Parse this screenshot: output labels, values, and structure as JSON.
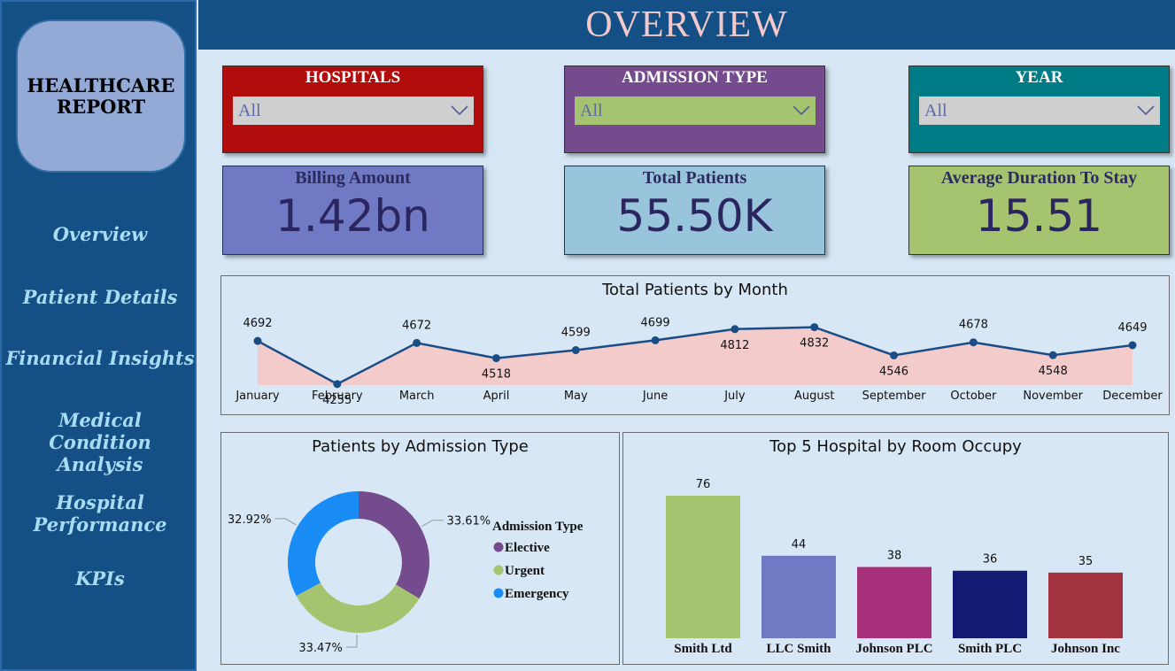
{
  "sidebar": {
    "report_title": "HEALTHCARE REPORT",
    "nav": [
      {
        "label": "Overview"
      },
      {
        "label": "Patient Details"
      },
      {
        "label": "Financial Insights"
      },
      {
        "label": "Medical Condition Analysis"
      },
      {
        "label": "Hospital Performance"
      },
      {
        "label": "KPIs"
      }
    ]
  },
  "header": {
    "title": "OVERVIEW"
  },
  "filters": {
    "hospitals": {
      "label": "HOSPITALS",
      "value": "All",
      "color": "#b20d0d"
    },
    "admission_type": {
      "label": "ADMISSION TYPE",
      "value": "All",
      "color": "#744b8c"
    },
    "year": {
      "label": "YEAR",
      "value": "All",
      "color": "#007c87"
    }
  },
  "kpis": {
    "billing": {
      "label": "Billing Amount",
      "value": "1.42bn",
      "color": "#7079c4"
    },
    "patients": {
      "label": "Total Patients",
      "value": "55.50K",
      "color": "#98c5dc"
    },
    "stay": {
      "label": "Average Duration To Stay",
      "value": "15.51",
      "color": "#a6c46f"
    }
  },
  "chart_data": [
    {
      "type": "area",
      "title": "Total Patients by Month",
      "x": [
        "January",
        "February",
        "March",
        "April",
        "May",
        "June",
        "July",
        "August",
        "September",
        "October",
        "November",
        "December"
      ],
      "series": [
        {
          "values": [
            4692,
            4255,
            4672,
            4518,
            4599,
            4699,
            4812,
            4832,
            4546,
            4678,
            4548,
            4649
          ],
          "color": "#1a4d85",
          "fill": "#f3cbcb"
        }
      ]
    },
    {
      "type": "pie",
      "title": "Patients by Admission Type",
      "legend_title": "Admission Type",
      "slices": [
        {
          "label": "Elective",
          "value": 33.61,
          "display": "33.61%",
          "color": "#744b8c"
        },
        {
          "label": "Urgent",
          "value": 33.47,
          "display": "33.47%",
          "color": "#a6c46f"
        },
        {
          "label": "Emergency",
          "value": 32.92,
          "display": "32.92%",
          "color": "#1a8cf5"
        }
      ]
    },
    {
      "type": "bar",
      "title": "Top 5 Hospital by Room Occupy",
      "categories": [
        "Smith Ltd",
        "LLC Smith",
        "Johnson PLC",
        "Smith PLC",
        "Johnson Inc"
      ],
      "values": [
        76,
        44,
        38,
        36,
        35
      ],
      "colors": [
        "#a6c46f",
        "#7079c4",
        "#a6307a",
        "#131a73",
        "#a2323d"
      ]
    }
  ]
}
